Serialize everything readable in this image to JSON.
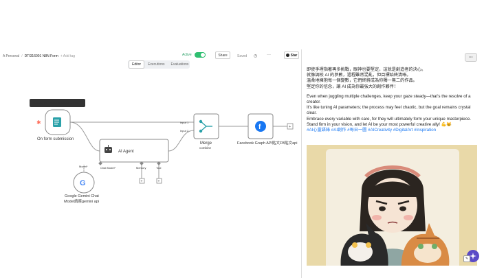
{
  "breadcrumb": {
    "owner": "A Personal",
    "separator": "/",
    "workflow": "DTI316001 N8N Form",
    "add_tag": "+ Add tag"
  },
  "header": {
    "active_label": "Active",
    "active": true,
    "share_label": "Share",
    "saved_label": "Saved",
    "star_label": "Star"
  },
  "tabs": [
    "Editor",
    "Executions",
    "Evaluations"
  ],
  "canvas": {
    "tooltip": "Waiting for you to submit the form",
    "nodes": {
      "form": "On form submission",
      "agent": "AI Agent",
      "merge": "Merge",
      "merge_sub": "combine",
      "merge_input1": "Input 1",
      "merge_input2": "Input 2",
      "facebook": "Facebook Graph API貼文FB貼文api",
      "gemini_line1": "Google Gemini Chat",
      "gemini_line2": "Model請座gemini api"
    },
    "ports": {
      "model": "Model*",
      "chat_model": "Chat Model*",
      "memory": "Memory",
      "tool": "Tool"
    },
    "colors": {
      "trigger_orange": "#ff6d5a",
      "facebook_blue": "#1877f2",
      "merge_teal": "#2aa1a9"
    }
  },
  "post": {
    "zh_line1": "即使手裡指著再多挑戰，眼神也要堅定，這就是創造者的決心。",
    "zh_line2": "就像調校 AI 的參數，過程雖然混亂，但目標始終清晰。",
    "zh_line3": "溫柔地擁抱每一個變數，它們終將成為你獨一無二的作品。",
    "zh_line4": "堅定你的信念，讓 AI 成為你最強大的創作夥伴！",
    "en_line1": "Even when juggling multiple challenges, keep your gaze steady—that's the resolve of a creator.",
    "en_line2": "It's like tuning AI parameters; the process may feel chaotic, but the goal remains crystal clear.",
    "en_line3": "Embrace every variable with care, for they will ultimately form your unique masterpiece.",
    "en_line4": "Stand firm in your vision, and let AI be your most powerful creative ally! 💪😼",
    "hashtags": "#AI心靈語錄 #AI創作 #每日一圖 #AICreativity #DigitalArt #Inspiration"
  }
}
